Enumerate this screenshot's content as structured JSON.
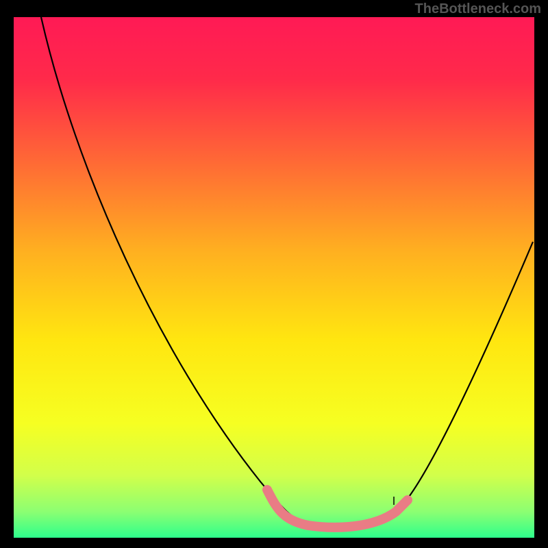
{
  "watermark": "TheBottleneck.com",
  "colors": {
    "gradient_top": "#ff1a55",
    "gradient_mid": "#ffe610",
    "gradient_bottom": "#2dff8c",
    "curve": "#000000",
    "trough_highlight": "#e97c85",
    "frame": "#000000"
  },
  "chart_data": {
    "type": "line",
    "title": "",
    "xlabel": "",
    "ylabel": "",
    "xlim": [
      0,
      100
    ],
    "ylim": [
      0,
      100
    ],
    "series": [
      {
        "name": "bottleneck-curve",
        "x": [
          5,
          15,
          25,
          35,
          45,
          50,
          55,
          60,
          65,
          70,
          75,
          80,
          90,
          100
        ],
        "y": [
          100,
          78,
          55,
          35,
          18,
          10,
          4,
          2,
          1,
          1,
          3,
          8,
          30,
          57
        ]
      }
    ],
    "annotations": [
      {
        "name": "optimal-range",
        "x_start": 50,
        "x_end": 75,
        "style": "flat-trough-highlight",
        "color": "#e97c85"
      }
    ],
    "background": {
      "style": "vertical-gradient",
      "stops": [
        {
          "pos": 0.0,
          "color": "#ff1a55"
        },
        {
          "pos": 0.28,
          "color": "#ff6a35"
        },
        {
          "pos": 0.62,
          "color": "#ffe610"
        },
        {
          "pos": 0.95,
          "color": "#8cff72"
        },
        {
          "pos": 1.0,
          "color": "#2dff8c"
        }
      ]
    }
  }
}
